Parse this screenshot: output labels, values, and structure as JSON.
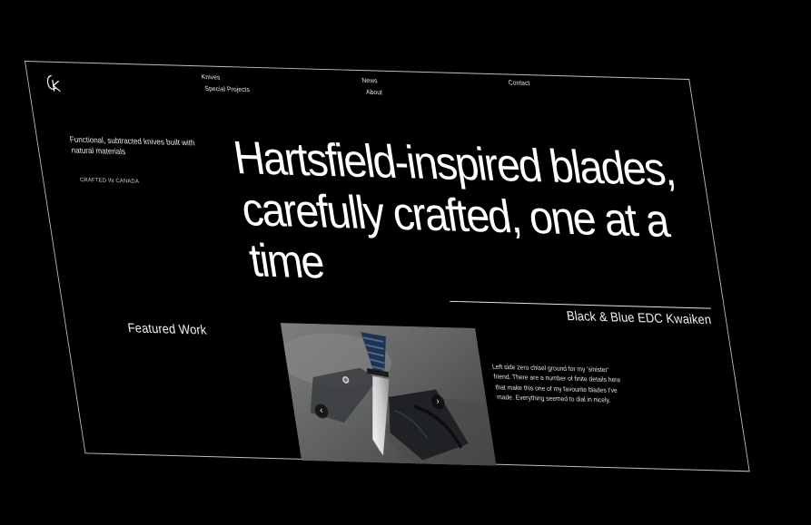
{
  "brand": {
    "logo_text": "CK"
  },
  "nav": {
    "knives": "Knives",
    "special_projects": "Special Projects",
    "news": "News",
    "about": "About",
    "contact": "Contact"
  },
  "intro": {
    "tagline": "Functional, subtracted knives built with natural materials",
    "location": "CRAFTED IN CANADA"
  },
  "hero": {
    "headline": "Hartsfield-inspired blades, carefully crafted, one at a time"
  },
  "featured": {
    "section_label": "Featured Work",
    "project_title": "Black & Blue EDC Kwaiken",
    "description": "Left side zero chisel ground for my 'sinister' friend. There are a number of finite details here that make this one of my favourite blades I've made. Everything seemed to dial in nicely.",
    "prev_icon": "‹",
    "next_icon": "›"
  },
  "colors": {
    "background": "#000000",
    "text": "#ffffff",
    "frame_border": "#bfbfbf"
  },
  "icons": {
    "prev": "chevron-left-icon",
    "next": "chevron-right-icon"
  }
}
